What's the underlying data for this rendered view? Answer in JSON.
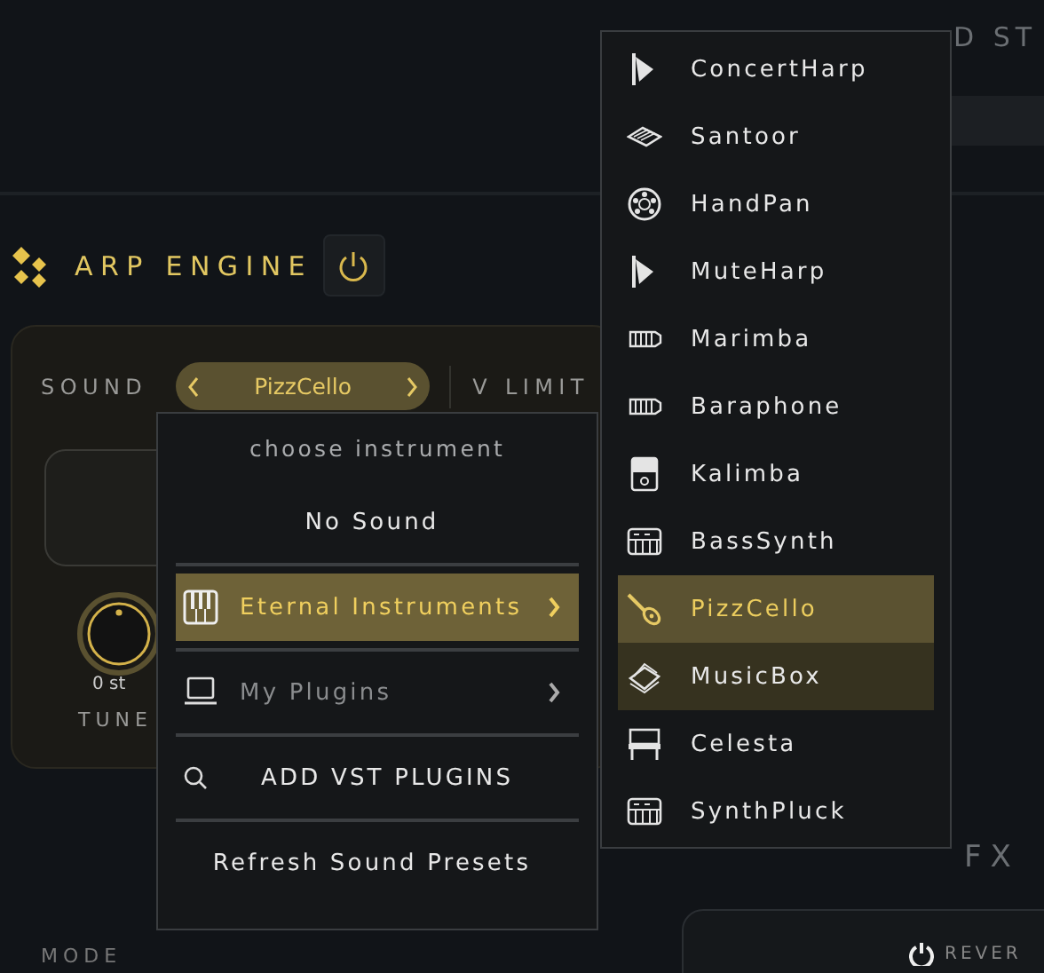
{
  "header": {
    "title": "D ST"
  },
  "arp_engine": {
    "title": "ARP ENGINE",
    "sound_label": "SOUND",
    "sound_value": "PizzCello",
    "v_limit_label": "V LIMIT",
    "tune": {
      "value": "0 st",
      "label": "TUNE",
      "level": 0.5
    }
  },
  "fx": {
    "title": "FX",
    "reverb": {
      "label": "REVER"
    }
  },
  "mode": {
    "label": "MODE"
  },
  "sound_menu": {
    "title": "choose instrument",
    "items": [
      {
        "kind": "text",
        "label": "No Sound",
        "selected": false,
        "disabled": false
      },
      {
        "kind": "category",
        "label": "Eternal Instruments",
        "selected": true,
        "disabled": false
      },
      {
        "kind": "category",
        "label": "My Plugins",
        "selected": false,
        "disabled": true
      },
      {
        "kind": "action",
        "label": "ADD VST PLUGINS",
        "selected": false,
        "disabled": false
      },
      {
        "kind": "text",
        "label": "Refresh Sound Presets",
        "selected": false,
        "disabled": false
      }
    ]
  },
  "instrument_menu": {
    "items": [
      {
        "label": "ConcertHarp",
        "selected": false,
        "hovered": false
      },
      {
        "label": "Santoor",
        "selected": false,
        "hovered": false
      },
      {
        "label": "HandPan",
        "selected": false,
        "hovered": false
      },
      {
        "label": "MuteHarp",
        "selected": false,
        "hovered": false
      },
      {
        "label": "Marimba",
        "selected": false,
        "hovered": false
      },
      {
        "label": "Baraphone",
        "selected": false,
        "hovered": false
      },
      {
        "label": "Kalimba",
        "selected": false,
        "hovered": false
      },
      {
        "label": "BassSynth",
        "selected": false,
        "hovered": false
      },
      {
        "label": "PizzCello",
        "selected": true,
        "hovered": false
      },
      {
        "label": "MusicBox",
        "selected": false,
        "hovered": true
      },
      {
        "label": "Celesta",
        "selected": false,
        "hovered": false
      },
      {
        "label": "SynthPluck",
        "selected": false,
        "hovered": false
      }
    ]
  }
}
